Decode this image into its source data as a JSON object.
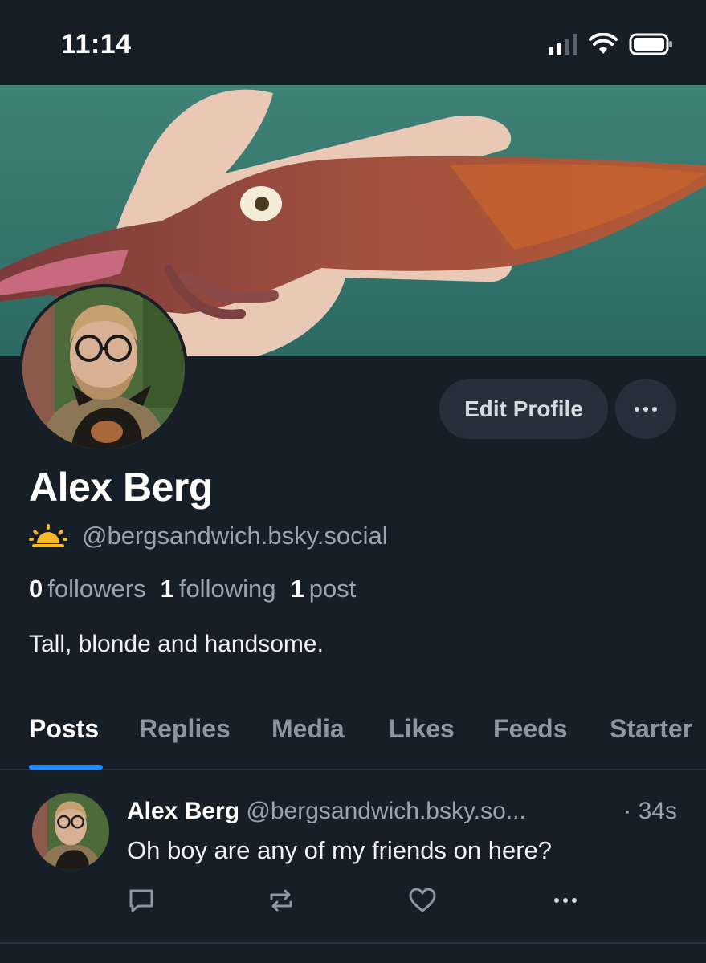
{
  "status_bar": {
    "time": "11:14",
    "icons": [
      "signal-icon",
      "wifi-icon",
      "battery-icon"
    ]
  },
  "profile": {
    "banner": "squid-banner-image",
    "display_name": "Alex Berg",
    "handle_emoji": "sunrise-icon",
    "handle": "@bergsandwich.bsky.social",
    "edit_label": "Edit Profile",
    "followers_count": "0",
    "followers_label": "followers",
    "following_count": "1",
    "following_label": "following",
    "posts_count": "1",
    "posts_label": "post",
    "bio": "Tall, blonde and handsome."
  },
  "tabs": [
    {
      "label": "Posts",
      "active": true
    },
    {
      "label": "Replies",
      "active": false
    },
    {
      "label": "Media",
      "active": false
    },
    {
      "label": "Likes",
      "active": false
    },
    {
      "label": "Feeds",
      "active": false
    },
    {
      "label": "Starter",
      "active": false
    }
  ],
  "posts": [
    {
      "author": "Alex Berg",
      "handle": "@bergsandwich.bsky.so...",
      "time": "· 34s",
      "text": "Oh boy are any of my friends on here?",
      "actions": [
        "reply-icon",
        "repost-icon",
        "like-icon",
        "more-icon"
      ]
    }
  ],
  "colors": {
    "background": "#161e27",
    "button": "#26303c",
    "accent": "#1f8bff",
    "muted": "#9aa4b1"
  }
}
